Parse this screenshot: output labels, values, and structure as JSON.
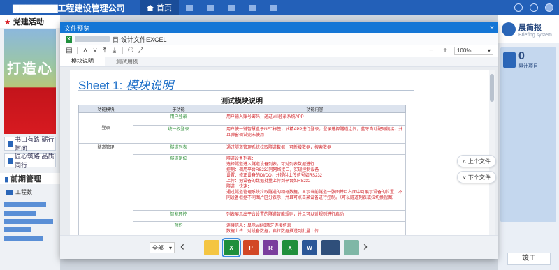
{
  "app": {
    "company": "▇▇▇▇▇▇▇工程建设管理公司",
    "nav": [
      {
        "label": "首页",
        "active": true
      },
      {
        "label": "",
        "active": false
      },
      {
        "label": "",
        "active": false
      },
      {
        "label": "",
        "active": false
      },
      {
        "label": "",
        "active": false
      },
      {
        "label": "",
        "active": false
      }
    ]
  },
  "left": {
    "party_title": "党建活动",
    "slogan": "打造心",
    "menu": [
      "书山有路 砺行阿问",
      "匠心筑路 品质同行"
    ],
    "phase_title": "前期管理",
    "legend": "工程数"
  },
  "right": {
    "brief_title": "晨简报",
    "brief_sub": "Briefing system",
    "count": "0",
    "count_label": "累计项目",
    "bottom_btn": "竣工"
  },
  "modal": {
    "title": "文件预览",
    "close": "×",
    "file_name": "目-设计文件EXCEL",
    "zoom_minus": "−",
    "zoom_plus": "+",
    "zoom_value": "100%",
    "tabs": [
      "模块说明",
      "测试用例"
    ],
    "sheet_title_prefix": "Sheet 1: ",
    "sheet_title_name": "模块说明",
    "table_caption": "测试模块说明",
    "headers": [
      "功能模块",
      "子功能",
      "功能内容"
    ],
    "rows": [
      {
        "module": "登录",
        "func": "用户登录",
        "content": "用户输入账号密码，通过wifi登录系统APP"
      },
      {
        "module": "",
        "func": "统一权登录",
        "content": "用户使一键智慧盒子NFC标签，油精APP进行登录，登录选择隧道之间，蓝牙自动配码链接，并且弹窗调试完未使用"
      },
      {
        "module": "隧道管理",
        "func": "隧道列表",
        "content": "通过隧道管理系统拉取隧道数据，可新增数据，搜索数据"
      },
      {
        "module": "",
        "func": "隧道定位",
        "content": "隧道设备列表：\n选择隧道进入隧道设备列表，可对列表数据进行：\n控制：调用平台RS232同网络接口，实现控制设备\n设置：修正设备的DI/DO，并提供上传信号如RS232\n上传：把设备的数据批量上传到平台如RS232\n隧道一快速：\n通过隧道管理系统拉取隧道的相母数据，显示当前隧道一张图并且右面中可展示设备的位置，不同设备根据不同图片区分表示，并且可点击某设备进行控制。（可以隧道列表或拉切换视图）"
      },
      {
        "module": "",
        "func": "智能环控",
        "content": "列表展示出平台设置的隧道智能规则，并且可以对规则进行启动"
      },
      {
        "module": "",
        "func": "预約",
        "content": "连接信息：显示wifi和蓝牙连接信息\n数据上传：对设备数据，启拉数据推送到批量上传"
      }
    ],
    "prev_file": "上个文件",
    "next_file": "下个文件",
    "filter": "全部",
    "thumbs": [
      {
        "type": "folder",
        "color": "#f4c542"
      },
      {
        "type": "excel-icon",
        "color": "#1f8f3c",
        "label": "X",
        "selected": true
      },
      {
        "type": "ppt-icon",
        "color": "#d24726",
        "label": "P"
      },
      {
        "type": "rar-icon",
        "color": "#7a3e9d",
        "label": "R"
      },
      {
        "type": "excel-icon",
        "color": "#1f8f3c",
        "label": "X"
      },
      {
        "type": "word-icon",
        "color": "#2b5797",
        "label": "W"
      },
      {
        "type": "image-icon",
        "color": "#2f4f7a",
        "label": ""
      },
      {
        "type": "drawing-icon",
        "color": "#7fb7a6",
        "label": ""
      }
    ]
  }
}
